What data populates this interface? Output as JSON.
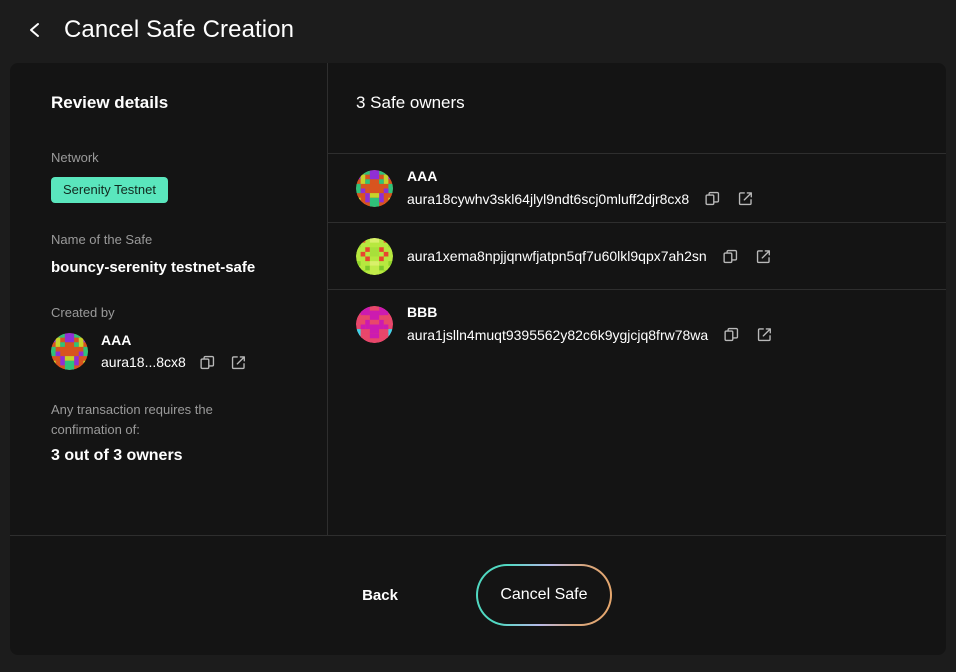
{
  "header": {
    "back_icon": "chevron-left-icon",
    "title": "Cancel Safe Creation"
  },
  "review": {
    "heading": "Review details",
    "network_label": "Network",
    "network_value": "Serenity Testnet",
    "network_badge_color": "#5ae6bd",
    "name_label": "Name of the Safe",
    "name_value": "bouncy-serenity testnet-safe",
    "created_by_label": "Created by",
    "creator": {
      "name": "AAA",
      "address": "aura18...8cx8",
      "copy_icon": "copy-icon",
      "external_icon": "external-link-icon"
    },
    "threshold_label": "Any transaction requires the confirmation of:",
    "threshold_value": "3 out of 3 owners"
  },
  "owners": {
    "title": "3 Safe owners",
    "rows": [
      {
        "name": "AAA",
        "address": "aura18cywhv3skl64jlyl9ndt6scj0mluff2djr8cx8",
        "copy_icon": "copy-icon",
        "external_icon": "external-link-icon"
      },
      {
        "name": "",
        "address": "aura1xema8npjjqnwfjatpn5qf7u60lkl9qpx7ah2sn",
        "copy_icon": "copy-icon",
        "external_icon": "external-link-icon"
      },
      {
        "name": "BBB",
        "address": "aura1jslln4muqt9395562y82c6k9ygjcjq8frw78wa",
        "copy_icon": "copy-icon",
        "external_icon": "external-link-icon"
      }
    ]
  },
  "footer": {
    "back_label": "Back",
    "cancel_label": "Cancel Safe",
    "cancel_gradient": [
      "#4fd8c0",
      "#b6b9e8",
      "#e8a76a"
    ]
  }
}
